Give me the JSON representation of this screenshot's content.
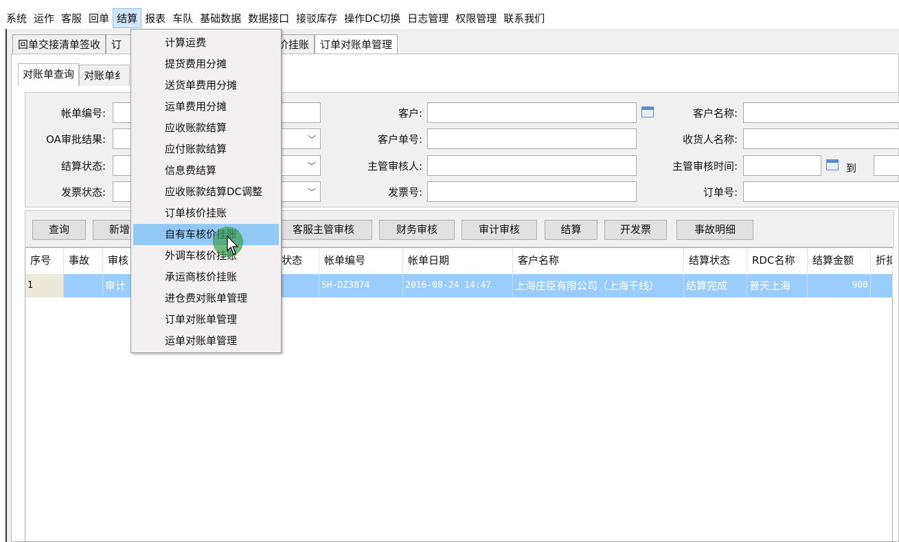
{
  "menubar": {
    "items": [
      "系统",
      "运作",
      "客服",
      "回单",
      "结算",
      "报表",
      "车队",
      "基础数据",
      "数据接口",
      "接驳库存",
      "操作DC切换",
      "日志管理",
      "权限管理",
      "联系我们"
    ],
    "active": "结算"
  },
  "tabs": [
    "回单交接清单签收",
    "订",
    "核价挂账",
    "订单对账单管理"
  ],
  "subtabs": [
    "对账单查询",
    "对账单纟"
  ],
  "form": {
    "bill_no": "帐单编号:",
    "oa_result": "OA审批结果:",
    "settle_status": "结算状态:",
    "invoice_status": "发票状态:",
    "customer": "客户:",
    "customer_order_no": "客户单号:",
    "supervisor": "主管审核人:",
    "invoice_no": "发票号:",
    "customer_name": "客户名称:",
    "consignee": "收货人名称:",
    "supervisor_time": "主管审核时间:",
    "to": "到",
    "order_no": "订单号:"
  },
  "buttons": {
    "query": "查询",
    "add": "新增",
    "cs_audit": "客服主管审核",
    "finance_audit": "财务审核",
    "audit_audit": "审计审核",
    "settle": "结算",
    "invoice": "开发票",
    "accident_detail": "事故明细"
  },
  "grid": {
    "columns": [
      "序号",
      "事故",
      "审核",
      "状态",
      "帐单编号",
      "帐单日期",
      "客户名称",
      "结算状态",
      "RDC名称",
      "结算金额",
      "折扣"
    ],
    "rows": [
      [
        "1",
        "",
        "审计",
        "",
        "SH-DZ3874",
        "2016-08-24 14:47",
        "上海庄臣有限公司（上海干线）",
        "结算完成",
        "普天上海",
        "900",
        ""
      ]
    ]
  },
  "dropdown": {
    "items": [
      "计算运费",
      "提货费用分摊",
      "送货单费用分摊",
      "运单费用分摊",
      "应收账款结算",
      "应付账款结算",
      "信息费结算",
      "应收账款结算DC调整",
      "订单核价挂账",
      "自有车核价挂账",
      "外调车核价挂账",
      "承运商核价挂账",
      "进仓费对账单管理",
      "订单对账单管理",
      "运单对账单管理"
    ],
    "highlighted": "自有车核价挂账"
  },
  "colors": {
    "selection": "#99ccff",
    "menu_highlight": "#91c9f7"
  }
}
